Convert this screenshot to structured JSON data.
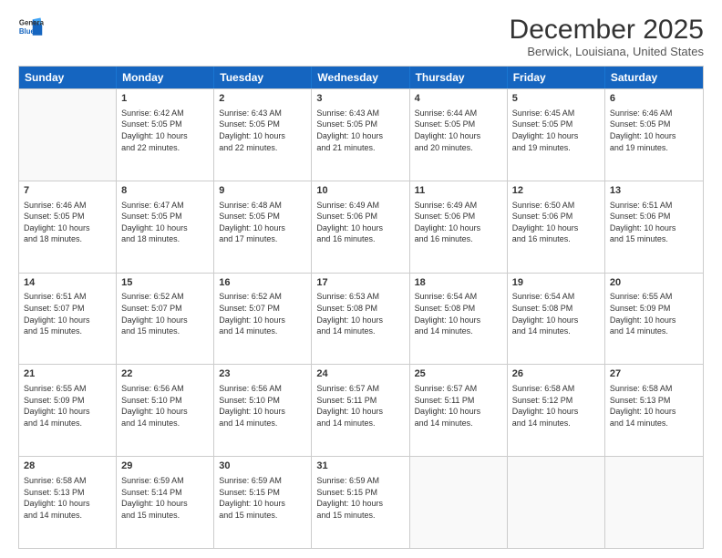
{
  "logo": {
    "line1": "General",
    "line2": "Blue"
  },
  "title": "December 2025",
  "subtitle": "Berwick, Louisiana, United States",
  "weekdays": [
    "Sunday",
    "Monday",
    "Tuesday",
    "Wednesday",
    "Thursday",
    "Friday",
    "Saturday"
  ],
  "rows": [
    [
      {
        "day": "",
        "info": ""
      },
      {
        "day": "1",
        "info": "Sunrise: 6:42 AM\nSunset: 5:05 PM\nDaylight: 10 hours\nand 22 minutes."
      },
      {
        "day": "2",
        "info": "Sunrise: 6:43 AM\nSunset: 5:05 PM\nDaylight: 10 hours\nand 22 minutes."
      },
      {
        "day": "3",
        "info": "Sunrise: 6:43 AM\nSunset: 5:05 PM\nDaylight: 10 hours\nand 21 minutes."
      },
      {
        "day": "4",
        "info": "Sunrise: 6:44 AM\nSunset: 5:05 PM\nDaylight: 10 hours\nand 20 minutes."
      },
      {
        "day": "5",
        "info": "Sunrise: 6:45 AM\nSunset: 5:05 PM\nDaylight: 10 hours\nand 19 minutes."
      },
      {
        "day": "6",
        "info": "Sunrise: 6:46 AM\nSunset: 5:05 PM\nDaylight: 10 hours\nand 19 minutes."
      }
    ],
    [
      {
        "day": "7",
        "info": "Sunrise: 6:46 AM\nSunset: 5:05 PM\nDaylight: 10 hours\nand 18 minutes."
      },
      {
        "day": "8",
        "info": "Sunrise: 6:47 AM\nSunset: 5:05 PM\nDaylight: 10 hours\nand 18 minutes."
      },
      {
        "day": "9",
        "info": "Sunrise: 6:48 AM\nSunset: 5:05 PM\nDaylight: 10 hours\nand 17 minutes."
      },
      {
        "day": "10",
        "info": "Sunrise: 6:49 AM\nSunset: 5:06 PM\nDaylight: 10 hours\nand 16 minutes."
      },
      {
        "day": "11",
        "info": "Sunrise: 6:49 AM\nSunset: 5:06 PM\nDaylight: 10 hours\nand 16 minutes."
      },
      {
        "day": "12",
        "info": "Sunrise: 6:50 AM\nSunset: 5:06 PM\nDaylight: 10 hours\nand 16 minutes."
      },
      {
        "day": "13",
        "info": "Sunrise: 6:51 AM\nSunset: 5:06 PM\nDaylight: 10 hours\nand 15 minutes."
      }
    ],
    [
      {
        "day": "14",
        "info": "Sunrise: 6:51 AM\nSunset: 5:07 PM\nDaylight: 10 hours\nand 15 minutes."
      },
      {
        "day": "15",
        "info": "Sunrise: 6:52 AM\nSunset: 5:07 PM\nDaylight: 10 hours\nand 15 minutes."
      },
      {
        "day": "16",
        "info": "Sunrise: 6:52 AM\nSunset: 5:07 PM\nDaylight: 10 hours\nand 14 minutes."
      },
      {
        "day": "17",
        "info": "Sunrise: 6:53 AM\nSunset: 5:08 PM\nDaylight: 10 hours\nand 14 minutes."
      },
      {
        "day": "18",
        "info": "Sunrise: 6:54 AM\nSunset: 5:08 PM\nDaylight: 10 hours\nand 14 minutes."
      },
      {
        "day": "19",
        "info": "Sunrise: 6:54 AM\nSunset: 5:08 PM\nDaylight: 10 hours\nand 14 minutes."
      },
      {
        "day": "20",
        "info": "Sunrise: 6:55 AM\nSunset: 5:09 PM\nDaylight: 10 hours\nand 14 minutes."
      }
    ],
    [
      {
        "day": "21",
        "info": "Sunrise: 6:55 AM\nSunset: 5:09 PM\nDaylight: 10 hours\nand 14 minutes."
      },
      {
        "day": "22",
        "info": "Sunrise: 6:56 AM\nSunset: 5:10 PM\nDaylight: 10 hours\nand 14 minutes."
      },
      {
        "day": "23",
        "info": "Sunrise: 6:56 AM\nSunset: 5:10 PM\nDaylight: 10 hours\nand 14 minutes."
      },
      {
        "day": "24",
        "info": "Sunrise: 6:57 AM\nSunset: 5:11 PM\nDaylight: 10 hours\nand 14 minutes."
      },
      {
        "day": "25",
        "info": "Sunrise: 6:57 AM\nSunset: 5:11 PM\nDaylight: 10 hours\nand 14 minutes."
      },
      {
        "day": "26",
        "info": "Sunrise: 6:58 AM\nSunset: 5:12 PM\nDaylight: 10 hours\nand 14 minutes."
      },
      {
        "day": "27",
        "info": "Sunrise: 6:58 AM\nSunset: 5:13 PM\nDaylight: 10 hours\nand 14 minutes."
      }
    ],
    [
      {
        "day": "28",
        "info": "Sunrise: 6:58 AM\nSunset: 5:13 PM\nDaylight: 10 hours\nand 14 minutes."
      },
      {
        "day": "29",
        "info": "Sunrise: 6:59 AM\nSunset: 5:14 PM\nDaylight: 10 hours\nand 15 minutes."
      },
      {
        "day": "30",
        "info": "Sunrise: 6:59 AM\nSunset: 5:15 PM\nDaylight: 10 hours\nand 15 minutes."
      },
      {
        "day": "31",
        "info": "Sunrise: 6:59 AM\nSunset: 5:15 PM\nDaylight: 10 hours\nand 15 minutes."
      },
      {
        "day": "",
        "info": ""
      },
      {
        "day": "",
        "info": ""
      },
      {
        "day": "",
        "info": ""
      }
    ]
  ]
}
